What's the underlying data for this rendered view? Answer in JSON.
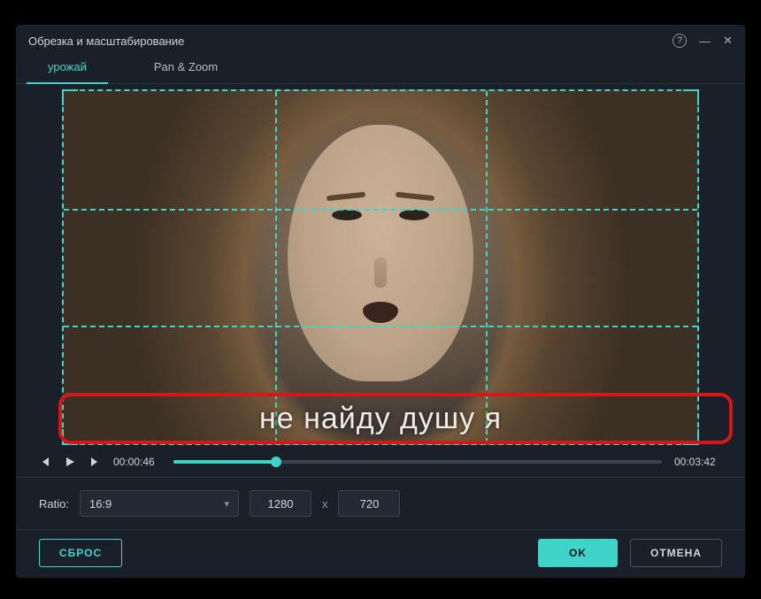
{
  "window": {
    "title": "Обрезка и масштабирование"
  },
  "tabs": {
    "crop": "урожай",
    "panzoom": "Pan & Zoom"
  },
  "subtitle": "не найду душу я",
  "playback": {
    "current": "00:00:46",
    "duration": "00:03:42",
    "progress_pct": 21
  },
  "ratio": {
    "label": "Ratio:",
    "selected": "16:9",
    "width": "1280",
    "sep": "x",
    "height": "720"
  },
  "buttons": {
    "reset": "СБРОС",
    "ok": "OK",
    "cancel": "ОТМЕНА"
  },
  "colors": {
    "accent": "#3fd4c9",
    "highlight": "#d11919"
  }
}
